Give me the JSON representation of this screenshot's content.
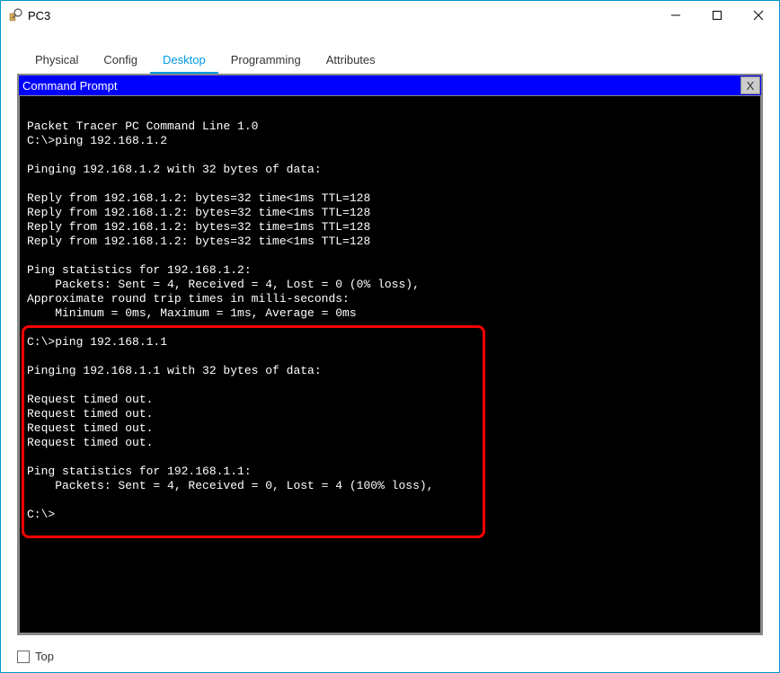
{
  "window": {
    "title": "PC3"
  },
  "tabs": {
    "physical": "Physical",
    "config": "Config",
    "desktop": "Desktop",
    "programming": "Programming",
    "attributes": "Attributes"
  },
  "panel": {
    "title": "Command Prompt",
    "close": "X"
  },
  "terminal": {
    "lines": [
      "",
      "Packet Tracer PC Command Line 1.0",
      "C:\\>ping 192.168.1.2",
      "",
      "Pinging 192.168.1.2 with 32 bytes of data:",
      "",
      "Reply from 192.168.1.2: bytes=32 time<1ms TTL=128",
      "Reply from 192.168.1.2: bytes=32 time<1ms TTL=128",
      "Reply from 192.168.1.2: bytes=32 time=1ms TTL=128",
      "Reply from 192.168.1.2: bytes=32 time<1ms TTL=128",
      "",
      "Ping statistics for 192.168.1.2:",
      "    Packets: Sent = 4, Received = 4, Lost = 0 (0% loss),",
      "Approximate round trip times in milli-seconds:",
      "    Minimum = 0ms, Maximum = 1ms, Average = 0ms",
      "",
      "C:\\>ping 192.168.1.1",
      "",
      "Pinging 192.168.1.1 with 32 bytes of data:",
      "",
      "Request timed out.",
      "Request timed out.",
      "Request timed out.",
      "Request timed out.",
      "",
      "Ping statistics for 192.168.1.1:",
      "    Packets: Sent = 4, Received = 0, Lost = 4 (100% loss),",
      "",
      "C:\\>"
    ]
  },
  "bottom": {
    "top_label": "Top"
  }
}
